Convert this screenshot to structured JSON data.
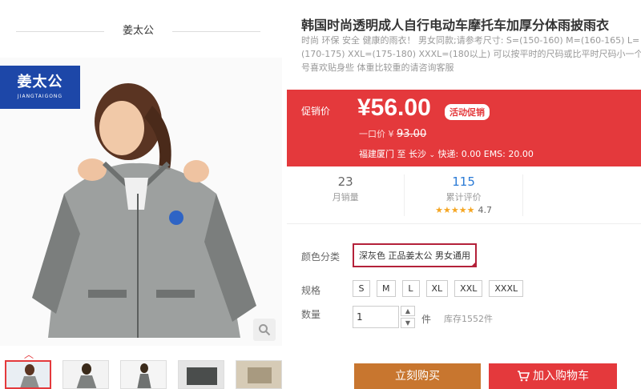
{
  "brand": {
    "header": "姜太公",
    "logo_cn": "姜太公",
    "logo_en": "JIANGTAIGONG"
  },
  "product": {
    "title": "韩国时尚透明成人自行电动车摩托车加厚分体雨披雨衣",
    "description": "时尚 环保 安全 健康的雨衣！ 男女同款;请参考尺寸: S=(150-160) M=(160-165) L=(170-175) XXL=(175-180) XXXL=(180以上) 可以按平时的尺码或比平时尺码小一个号喜欢贴身些 体重比较重的请咨询客服"
  },
  "price": {
    "label": "促销价",
    "value": "¥56.00",
    "promo_tag": "活动促销",
    "old_label": "一口价 ¥",
    "old_value": "93.00",
    "ship_from": "福建厦门",
    "ship_to_label": "至",
    "ship_to": "长沙",
    "shipping": "快递: 0.00 EMS: 20.00"
  },
  "stats": {
    "sales_value": "23",
    "sales_label": "月销量",
    "reviews_value": "115",
    "reviews_label": "累计评价",
    "rating_stars": "★★★★★",
    "rating_score": "4.7"
  },
  "options": {
    "color_label": "颜色分类",
    "color_selected": "深灰色 正品姜太公 男女通用",
    "size_label": "规格",
    "sizes": [
      "S",
      "M",
      "L",
      "XL",
      "XXL",
      "XXXL"
    ],
    "qty_label": "数量",
    "qty_value": "1",
    "qty_unit": "件",
    "stock": "库存1552件"
  },
  "actions": {
    "buy_now": "立刻购买",
    "add_to_cart": "加入购物车"
  },
  "colors": {
    "accent_red": "#e4393c",
    "buy_orange": "#c8762f",
    "brand_blue": "#1d47a8",
    "selected_border": "#b4213a"
  }
}
